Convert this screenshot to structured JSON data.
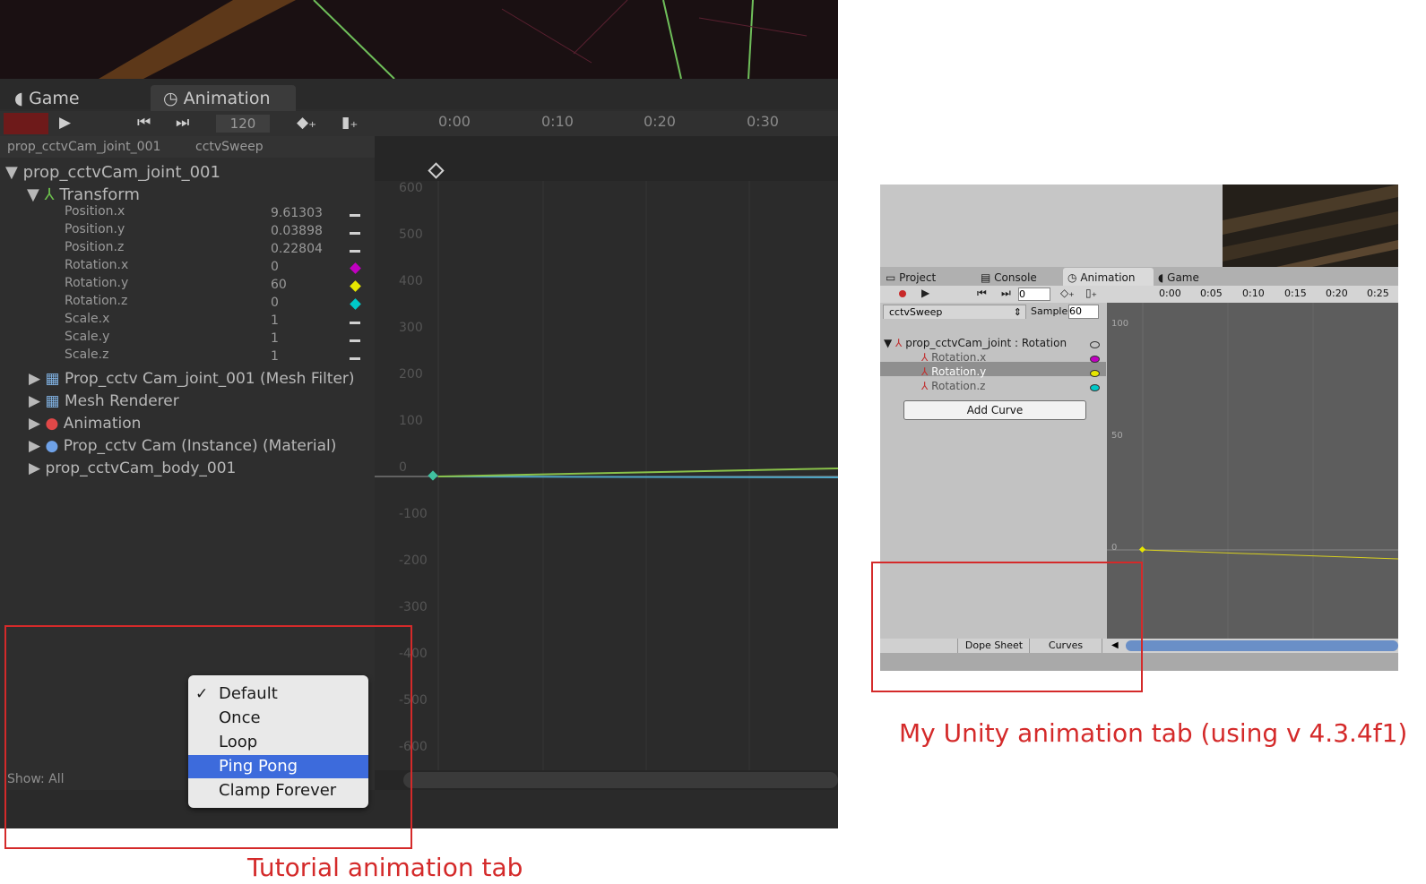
{
  "tutorial": {
    "tabs": {
      "game": "Game",
      "animation": "Animation"
    },
    "frame_value": "120",
    "ruler": [
      "0:00",
      "0:10",
      "0:20",
      "0:30"
    ],
    "clip_selector": {
      "object": "prop_cctvCam_joint_001",
      "clip": "cctvSweep"
    },
    "root": "prop_cctvCam_joint_001",
    "transform": "Transform",
    "properties": [
      {
        "name": "Position.x",
        "value": "9.61303"
      },
      {
        "name": "Position.y",
        "value": "0.03898"
      },
      {
        "name": "Position.z",
        "value": "0.22804"
      },
      {
        "name": "Rotation.x",
        "value": "0"
      },
      {
        "name": "Rotation.y",
        "value": "60"
      },
      {
        "name": "Rotation.z",
        "value": "0"
      },
      {
        "name": "Scale.x",
        "value": "1"
      },
      {
        "name": "Scale.y",
        "value": "1"
      },
      {
        "name": "Scale.z",
        "value": "1"
      }
    ],
    "components": [
      "Prop_cctv Cam_joint_001 (Mesh Filter)",
      "Mesh Renderer",
      "Animation",
      "Prop_cctv Cam (Instance) (Material)"
    ],
    "body": "prop_cctvCam_body_001",
    "y_labels": [
      "600",
      "500",
      "400",
      "300",
      "200",
      "100",
      "0",
      "-100",
      "-200",
      "-300",
      "-400",
      "-500",
      "-600"
    ],
    "show_all": "Show: All",
    "wrap_menu": {
      "options": [
        "Default",
        "Once",
        "Loop",
        "Ping Pong",
        "Clamp Forever"
      ],
      "checked": "Default",
      "highlighted": "Ping Pong",
      "check_mark": "✓"
    },
    "caption": "Tutorial animation tab"
  },
  "mine": {
    "tabs": {
      "project": "Project",
      "console": "Console",
      "animation": "Animation",
      "game": "Game"
    },
    "frame_value": "0",
    "ruler": [
      "0:00",
      "0:05",
      "0:10",
      "0:15",
      "0:20",
      "0:25"
    ],
    "clip": "cctvSweep",
    "sample_label": "Sample",
    "sample_value": "60",
    "root": "prop_cctvCam_joint : Rotation",
    "curves": [
      "Rotation.x",
      "Rotation.y",
      "Rotation.z"
    ],
    "selected_curve": "Rotation.y",
    "add_curve": "Add Curve",
    "y_labels": [
      "100",
      "50",
      "0"
    ],
    "dope_sheet": "Dope Sheet",
    "curves_tab": "Curves",
    "caption": "My Unity animation tab (using v 4.3.4f1)"
  },
  "colors": {
    "highlight": "#d42a2a",
    "menu_selected": "#3d6bdc",
    "rotation_x": "#c000c0",
    "rotation_y": "#e6e600",
    "rotation_z": "#00c8c8"
  }
}
